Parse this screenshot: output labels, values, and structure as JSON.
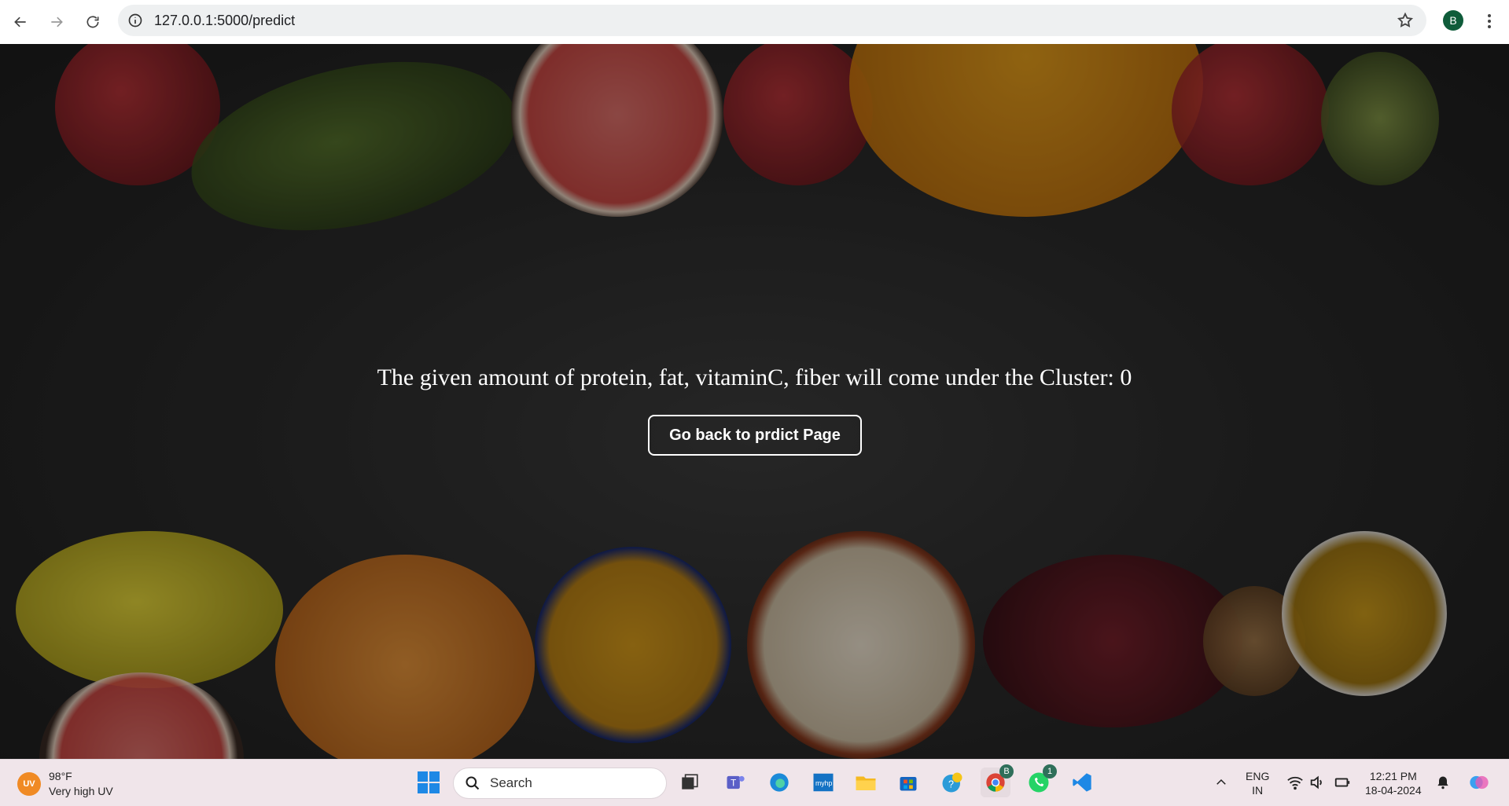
{
  "browser": {
    "url": "127.0.0.1:5000/predict",
    "profile_initial": "B"
  },
  "page": {
    "result_text": "The given amount of protein, fat, vitaminC, fiber will come under the Cluster: 0",
    "back_button_label": "Go back to prdict Page"
  },
  "taskbar": {
    "weather_temp": "98°F",
    "weather_desc": "Very high UV",
    "uv_label": "UV",
    "search_label": "Search",
    "chrome_badge": "B",
    "whatsapp_badge": "1",
    "lang_primary": "ENG",
    "lang_secondary": "IN",
    "time": "12:21 PM",
    "date": "18-04-2024"
  },
  "colors": {
    "page_background": "#2a2a2a",
    "text": "#ffffff",
    "taskbar": "#f0e5ea"
  }
}
